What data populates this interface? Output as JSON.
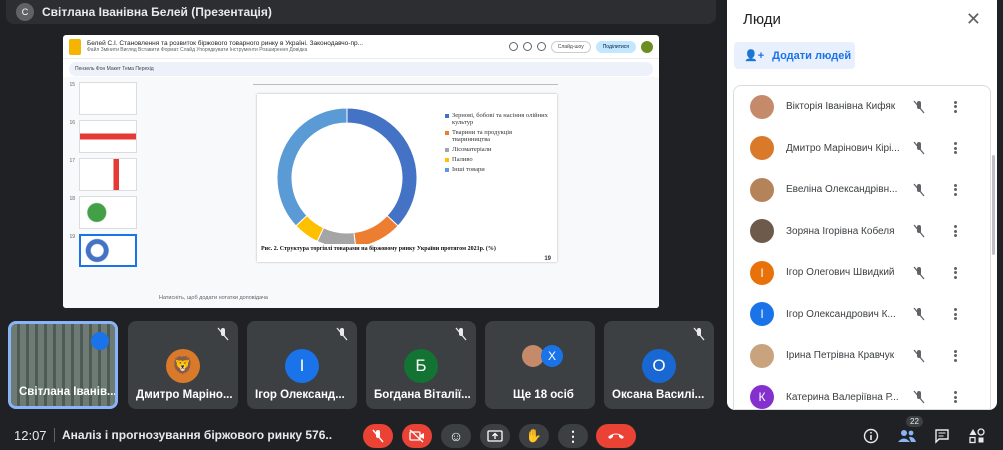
{
  "presenter": {
    "name": "Світлана Іванівна Белей (Презентація)",
    "avatar_initial": "С"
  },
  "screen": {
    "doc_title": "Белей С.І. Становлення та розвиток біржового товарного ринку в Україні. Законодавчо-пр...",
    "menu": "Файл  Змінити  Вигляд  Вставити  Формат  Слайд  Упорядкувати  Інструменти  Розширення  Довідка",
    "slideshow_pill": "Слайд-шоу",
    "share": "Поділитися",
    "toolbar": "Пензель    Фон    Макет    Тема    Перехід",
    "thumb_numbers": [
      "15",
      "16",
      "17",
      "18",
      "19"
    ],
    "speaker_notes": "Натисніть, щоб додати нотатки доповідача",
    "slide": {
      "legend": [
        {
          "label": "Зернові, бобові та насіння олійних культур",
          "color": "#4472c4"
        },
        {
          "label": "Тварини та продукція тваринництва",
          "color": "#ed7d31"
        },
        {
          "label": "Лісоматеріали",
          "color": "#a5a5a5"
        },
        {
          "label": "Паливо",
          "color": "#ffc000"
        },
        {
          "label": "Інші товари",
          "color": "#5b9bd5"
        }
      ],
      "caption": "Рис. 2. Структура торгівлі товарами на біржовому ринку України протягом 2021р. (%)",
      "page_number": "19"
    }
  },
  "chart_data": {
    "type": "pie",
    "categories": [
      "Зернові, бобові та насіння олійних культур",
      "Тварини та продукція тваринництва",
      "Лісоматеріали",
      "Паливо",
      "Інші товари"
    ],
    "values": [
      37,
      11,
      9,
      6,
      37
    ],
    "colors": [
      "#4472c4",
      "#ed7d31",
      "#a5a5a5",
      "#ffc000",
      "#5b9bd5"
    ],
    "title": "Рис. 2. Структура торгівлі товарами на біржовому ринку України протягом 2021р. (%)"
  },
  "tiles": [
    {
      "name": "Світлана Іванів...",
      "active": true
    },
    {
      "name": "Дмитро Маріно...",
      "avatar": "lion"
    },
    {
      "name": "Ігор Олександ...",
      "initial": "І",
      "color": "#1a73e8"
    },
    {
      "name": "Богдана Віталії...",
      "initial": "Б",
      "color": "#137333"
    },
    {
      "name": "Ще 18 осіб",
      "initial": "К",
      "color": "#1a73e8"
    },
    {
      "name": "Оксана Василі...",
      "initial": "О",
      "color": "#1967d2"
    }
  ],
  "people": {
    "title": "Люди",
    "add_label": "Додати людей",
    "list": [
      {
        "name": "Вікторія Іванівна Кифяк",
        "initial": "",
        "color": "#c48a6a"
      },
      {
        "name": "Дмитро Марінович Кірі...",
        "initial": "",
        "color": "#d97a2b"
      },
      {
        "name": "Евеліна Олександрівн...",
        "initial": "",
        "color": "#b5835a"
      },
      {
        "name": "Зоряна Ігорівна Кобеля",
        "initial": "",
        "color": "#6d5a4a"
      },
      {
        "name": "Ігор Олегович Швидкий",
        "initial": "І",
        "color": "#e8710a"
      },
      {
        "name": "Ігор Олександрович К...",
        "initial": "І",
        "color": "#1a73e8"
      },
      {
        "name": "Ірина Петрівна Кравчук",
        "initial": "",
        "color": "#c9a27e"
      },
      {
        "name": "Катерина Валеріївна Р...",
        "initial": "К",
        "color": "#8430ce"
      }
    ]
  },
  "bottom": {
    "time": "12:07",
    "meeting_title": "Аналіз і прогнозування біржового ринку 576...",
    "people_count": "22"
  }
}
